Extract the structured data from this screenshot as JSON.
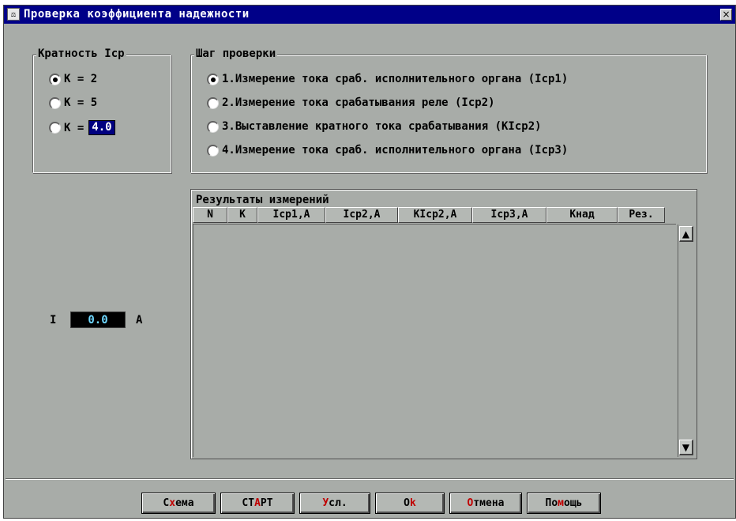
{
  "window": {
    "title": "Проверка коэффициента надежности",
    "icon": "scales-icon",
    "close_label": "×"
  },
  "multiplicity": {
    "label": "Кратность Icp",
    "options": [
      {
        "label": "K = 2",
        "checked": true
      },
      {
        "label": "K = 5",
        "checked": false
      },
      {
        "label": "K =",
        "checked": false,
        "input_value": "4.0"
      }
    ]
  },
  "steps": {
    "label": "Шаг проверки",
    "options": [
      {
        "label": "1.Измерение тока сраб. исполнительного органа (Icp1)",
        "checked": true
      },
      {
        "label": "2.Измерение тока срабатывания реле (Icp2)",
        "checked": false
      },
      {
        "label": "3.Выставление кратного тока срабатывания (KIcp2)",
        "checked": false
      },
      {
        "label": "4.Измерение тока сраб. исполнительного органа (Icp3)",
        "checked": false
      }
    ]
  },
  "current": {
    "label": "I",
    "value": "0.0",
    "unit": "A"
  },
  "results": {
    "title": "Результаты измерений",
    "columns": [
      "N",
      "K",
      "Icp1,A",
      "Icp2,A",
      "KIcp2,A",
      "Icp3,A",
      "Кнад",
      "Рез."
    ],
    "rows": []
  },
  "buttons": [
    {
      "pre": "С",
      "hk": "х",
      "post": "ема"
    },
    {
      "pre": "СТ",
      "hk": "А",
      "post": "РТ"
    },
    {
      "pre": "",
      "hk": "У",
      "post": "сл."
    },
    {
      "pre": "О",
      "hk": "k",
      "post": ""
    },
    {
      "pre": "",
      "hk": "О",
      "post": "тмена"
    },
    {
      "pre": "По",
      "hk": "м",
      "post": "ощь"
    }
  ],
  "colors": {
    "titlebar": "#000088",
    "window_bg": "#a8aca8",
    "input_highlight": "#000080",
    "value_display_text": "#6fd8ff",
    "hotkey": "#c00000"
  }
}
